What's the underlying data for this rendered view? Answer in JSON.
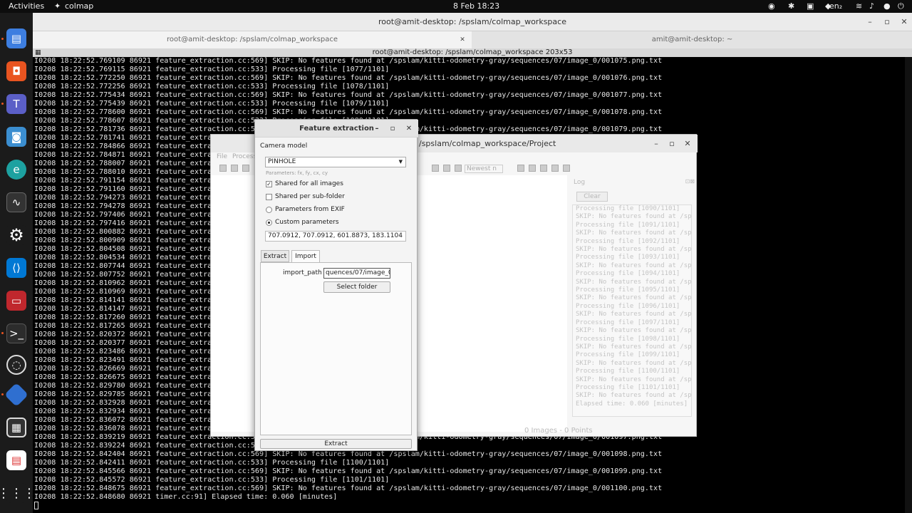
{
  "topbar": {
    "activities": "Activities",
    "app_name": "colmap",
    "clock": "8 Feb  18:23",
    "lang": "en₂"
  },
  "dock": {
    "items": [
      {
        "name": "files",
        "icon": "file-manager-icon",
        "color": "#3d7ee0"
      },
      {
        "name": "software",
        "icon": "store-icon",
        "color": "#e95420"
      },
      {
        "name": "teams",
        "icon": "teams-icon",
        "color": "#5b5fc7"
      },
      {
        "name": "screenshot",
        "icon": "camera-icon",
        "color": "#3b8ed0"
      },
      {
        "name": "edge-beta",
        "icon": "edge-icon",
        "color": "#1da1a0"
      },
      {
        "name": "system-monitor",
        "icon": "monitor-icon",
        "color": "#333"
      },
      {
        "name": "settings",
        "icon": "gear-icon",
        "color": "#777"
      },
      {
        "name": "vscode",
        "icon": "vscode-icon",
        "color": "#0078d4"
      },
      {
        "name": "terminal-red",
        "icon": "terminal-icon",
        "color": "#c0272d"
      },
      {
        "name": "terminal",
        "icon": "terminal-icon",
        "color": "#2c2c2c"
      },
      {
        "name": "obs",
        "icon": "obs-icon",
        "color": "#222"
      },
      {
        "name": "colmap",
        "icon": "colmap-icon",
        "color": "#2f6fd0"
      },
      {
        "name": "chip",
        "icon": "chip-icon",
        "color": "#333"
      },
      {
        "name": "document",
        "icon": "document-icon",
        "color": "#d33"
      },
      {
        "name": "apps",
        "icon": "apps-grid-icon",
        "color": "#1b1b1b"
      }
    ]
  },
  "terminal": {
    "title": "root@amit-desktop: /spslam/colmap_workspace",
    "tab_active": "root@amit-desktop: /spslam/colmap_workspace",
    "tab_inactive": "amit@amit-desktop: ~",
    "status": "root@amit-desktop: /spslam/colmap_workspace 203x53",
    "lines": [
      "I0208 18:22:52.769109 86921 feature_extraction.cc:569] SKIP: No features found at /spslam/kitti-odometry-gray/sequences/07/image_0/001075.png.txt",
      "I0208 18:22:52.769115 86921 feature_extraction.cc:533] Processing file [1077/1101]",
      "I0208 18:22:52.772250 86921 feature_extraction.cc:569] SKIP: No features found at /spslam/kitti-odometry-gray/sequences/07/image_0/001076.png.txt",
      "I0208 18:22:52.772256 86921 feature_extraction.cc:533] Processing file [1078/1101]",
      "I0208 18:22:52.775434 86921 feature_extraction.cc:569] SKIP: No features found at /spslam/kitti-odometry-gray/sequences/07/image_0/001077.png.txt",
      "I0208 18:22:52.775439 86921 feature_extraction.cc:533] Processing file [1079/1101]",
      "I0208 18:22:52.778600 86921 feature_extraction.cc:569] SKIP: No features found at /spslam/kitti-odometry-gray/sequences/07/image_0/001078.png.txt",
      "I0208 18:22:52.778607 86921 feature_extraction.cc:533] Processing file [1080/1101]",
      "I0208 18:22:52.781736 86921 feature_extraction.cc:569] SKIP: No features found at /spslam/kitti-odometry-gray/sequences/07/image_0/001079.png.txt",
      "I0208 18:22:52.781741 86921 feature_extraction.cc:533] Processing file [1081/1101]",
      "I0208 18:22:52.784866 86921 feature_extraction.cc:569] SKIP: No features found at /spslam/kitti-odometry-gray/sequences/07/image_0/001080.png.txt",
      "I0208 18:22:52.784871 86921 feature_extraction.cc:533] Processing file [1082/1101]",
      "I0208 18:22:52.788007 86921 feature_extraction.cc:569] SKIP: No features found at /spslam/kitti-odometry-gray/sequences/07/image_0/001081.png.txt",
      "I0208 18:22:52.788010 86921 feature_extraction.cc:533] Processing file [1083/1101]",
      "I0208 18:22:52.791154 86921 feature_extraction.cc:569] SKIP: No features found at /spslam/kitti-odometry-gray/sequences/07/image_0/001082.png.txt",
      "I0208 18:22:52.791160 86921 feature_extraction.cc:533] Processing file [1084/1101]",
      "I0208 18:22:52.794273 86921 feature_extraction.cc:569] SKIP: No features found at /spslam/kitti-odometry-gray/sequences/07/image_0/001083.png.txt",
      "I0208 18:22:52.794278 86921 feature_extraction.cc:533] Processing file [1085/1101]",
      "I0208 18:22:52.797406 86921 feature_extraction.cc:569] SKIP: No features found at /spslam/kitti-odometry-gray/sequences/07/image_0/001084.png.txt",
      "I0208 18:22:52.797416 86921 feature_extraction.cc:533] Processing file [1086/1101]",
      "I0208 18:22:52.800882 86921 feature_extraction.cc:569] SKIP: No features found at /spslam/kitti-odometry-gray/sequences/07/image_0/001085.png.txt",
      "I0208 18:22:52.800909 86921 feature_extraction.cc:533] Processing file [1087/1101]",
      "I0208 18:22:52.804508 86921 feature_extraction.cc:569] SKIP: No features found at /spslam/kitti-odometry-gray/sequences/07/image_0/001086.png.txt",
      "I0208 18:22:52.804534 86921 feature_extraction.cc:533] Processing file [1088/1101]",
      "I0208 18:22:52.807744 86921 feature_extraction.cc:569] SKIP: No features found at /spslam/kitti-odometry-gray/sequences/07/image_0/001087.png.txt",
      "I0208 18:22:52.807752 86921 feature_extraction.cc:533] Processing file [1089/1101]",
      "I0208 18:22:52.810962 86921 feature_extraction.cc:569] SKIP: No features found at /spslam/kitti-odometry-gray/sequences/07/image_0/001088.png.txt",
      "I0208 18:22:52.810969 86921 feature_extraction.cc:533] Processing file [1090/1101]",
      "I0208 18:22:52.814141 86921 feature_extraction.cc:569] SKIP: No features found at /spslam/kitti-odometry-gray/sequences/07/image_0/001089.png.txt",
      "I0208 18:22:52.814147 86921 feature_extraction.cc:533] Processing file [1091/1101]",
      "I0208 18:22:52.817260 86921 feature_extraction.cc:569] SKIP: No features found at /spslam/kitti-odometry-gray/sequences/07/image_0/001090.png.txt",
      "I0208 18:22:52.817265 86921 feature_extraction.cc:533] Processing file [1092/1101]",
      "I0208 18:22:52.820372 86921 feature_extraction.cc:569] SKIP: No features found at /spslam/kitti-odometry-gray/sequences/07/image_0/001091.png.txt",
      "I0208 18:22:52.820377 86921 feature_extraction.cc:533] Processing file [1093/1101]",
      "I0208 18:22:52.823486 86921 feature_extraction.cc:569] SKIP: No features found at /spslam/kitti-odometry-gray/sequences/07/image_0/001092.png.txt",
      "I0208 18:22:52.823491 86921 feature_extraction.cc:533] Processing file [1094/1101]",
      "I0208 18:22:52.826669 86921 feature_extraction.cc:569] SKIP: No features found at /spslam/kitti-odometry-gray/sequences/07/image_0/001093.png.txt",
      "I0208 18:22:52.826675 86921 feature_extraction.cc:533] Processing file [1095/1101]",
      "I0208 18:22:52.829780 86921 feature_extraction.cc:569] SKIP: No features found at /spslam/kitti-odometry-gray/sequences/07/image_0/001094.png.txt",
      "I0208 18:22:52.829785 86921 feature_extraction.cc:533] Processing file [1096/1101]",
      "I0208 18:22:52.832928 86921 feature_extraction.cc:569] SKIP: No features found at /spslam/kitti-odometry-gray/sequences/07/image_0/001095.png.txt",
      "I0208 18:22:52.832934 86921 feature_extraction.cc:533] Processing file [1097/1101]",
      "I0208 18:22:52.836072 86921 feature_extraction.cc:569] SKIP: No features found at /spslam/kitti-odometry-gray/sequences/07/image_0/001096.png.txt",
      "I0208 18:22:52.836078 86921 feature_extraction.cc:533] Processing file [1098/1101]",
      "I0208 18:22:52.839219 86921 feature_extraction.cc:569] SKIP: No features found at /spslam/kitti-odometry-gray/sequences/07/image_0/001097.png.txt",
      "I0208 18:22:52.839224 86921 feature_extraction.cc:533] Processing file [1099/1101]",
      "I0208 18:22:52.842404 86921 feature_extraction.cc:569] SKIP: No features found at /spslam/kitti-odometry-gray/sequences/07/image_0/001098.png.txt",
      "I0208 18:22:52.842411 86921 feature_extraction.cc:533] Processing file [1100/1101]",
      "I0208 18:22:52.845566 86921 feature_extraction.cc:569] SKIP: No features found at /spslam/kitti-odometry-gray/sequences/07/image_0/001099.png.txt",
      "I0208 18:22:52.845572 86921 feature_extraction.cc:533] Processing file [1101/1101]",
      "I0208 18:22:52.848675 86921 feature_extraction.cc:569] SKIP: No features found at /spslam/kitti-odometry-gray/sequences/07/image_0/001100.png.txt",
      "I0208 18:22:52.848680 86921 timer.cc:91] Elapsed time: 0.060 [minutes]"
    ]
  },
  "colmap_window": {
    "title": "/spslam/colmap_workspace/Project",
    "menu_file": "File",
    "menu_processing": "Processing",
    "toolbar_dropdown": "Newest n",
    "log_title": "Log",
    "log_clear": "Clear",
    "log_lines": [
      "Processing file [1090/1101]",
      "SKIP: No features found at /sp",
      "Processing file [1091/1101]",
      "SKIP: No features found at /sp",
      "Processing file [1092/1101]",
      "SKIP: No features found at /sp",
      "Processing file [1093/1101]",
      "SKIP: No features found at /sp",
      "Processing file [1094/1101]",
      "SKIP: No features found at /sp",
      "Processing file [1095/1101]",
      "SKIP: No features found at /sp",
      "Processing file [1096/1101]",
      "SKIP: No features found at /sp",
      "Processing file [1097/1101]",
      "SKIP: No features found at /sp",
      "Processing file [1098/1101]",
      "SKIP: No features found at /sp",
      "Processing file [1099/1101]",
      "SKIP: No features found at /sp",
      "Processing file [1100/1101]",
      "SKIP: No features found at /sp",
      "Processing file [1101/1101]",
      "SKIP: No features found at /sp",
      "Elapsed time: 0.060 [minutes]"
    ],
    "status": "0 Images - 0 Points"
  },
  "feature_dialog": {
    "title": "Feature extraction",
    "camera_model_label": "Camera model",
    "camera_model_value": "PINHOLE",
    "params_hint": "Parameters: fx, fy, cx, cy",
    "shared_all": "Shared for all images",
    "shared_subfolder": "Shared per sub-folder",
    "params_exif": "Parameters from EXIF",
    "custom_params": "Custom parameters",
    "custom_params_value": "707.0912, 707.0912, 601.8873, 183.1104",
    "tab_extract": "Extract",
    "tab_import": "Import",
    "import_path_label": "import_path",
    "import_path_value": "quences/07/image_0",
    "select_folder": "Select folder",
    "extract_button": "Extract"
  }
}
